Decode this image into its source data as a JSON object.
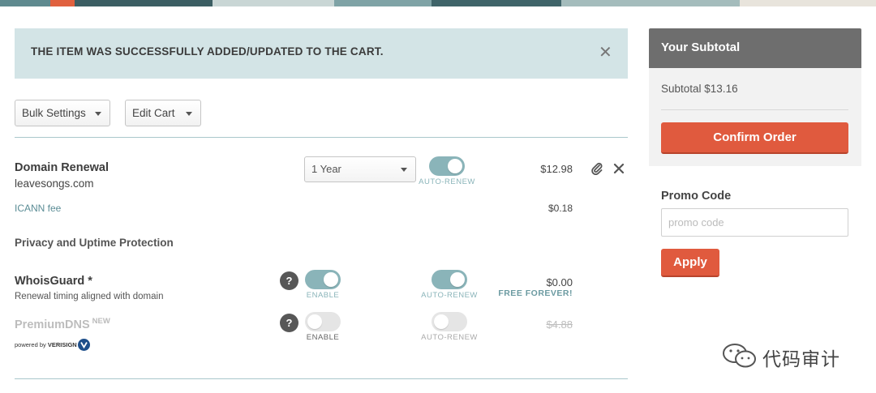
{
  "alert": {
    "message": "THE ITEM WAS SUCCESSFULLY ADDED/UPDATED TO THE CART.",
    "close_glyph": "✕"
  },
  "toolbar": {
    "bulk_settings_label": "Bulk Settings",
    "edit_cart_label": "Edit Cart"
  },
  "cart": {
    "domain": {
      "title": "Domain Renewal",
      "name": "leavesongs.com",
      "term": "1 Year",
      "auto_renew_label": "AUTO-RENEW",
      "auto_renew_on": true,
      "price": "$12.98",
      "icann_label": "ICANN fee",
      "icann_price": "$0.18"
    },
    "privacy_heading": "Privacy and Uptime Protection",
    "whoisguard": {
      "title": "WhoisGuard *",
      "subtitle": "Renewal timing aligned with domain",
      "enable_label": "ENABLE",
      "auto_renew_label": "AUTO-RENEW",
      "price": "$0.00",
      "price_note": "FREE FOREVER!"
    },
    "premiumdns": {
      "title": "PremiumDNS",
      "badge": "NEW",
      "powered_by": "powered by",
      "powered_brand": "VERISIGN",
      "enable_label": "ENABLE",
      "auto_renew_label": "AUTO-RENEW",
      "price": "$4.88"
    }
  },
  "sidebar": {
    "heading": "Your Subtotal",
    "subtotal": "Subtotal $13.16",
    "confirm_label": "Confirm Order"
  },
  "promo": {
    "label": "Promo Code",
    "placeholder": "promo code",
    "value": "",
    "apply_label": "Apply"
  },
  "watermark": {
    "text": "代码审计"
  },
  "colors": {
    "accent": "#e05a3e",
    "toggle_on": "#8ab4b9",
    "alert_bg": "#d3e4e6",
    "sidebar_head": "#6e6e6e"
  }
}
